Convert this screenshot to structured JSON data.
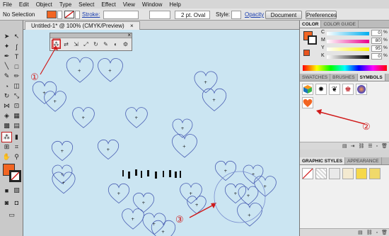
{
  "menu": [
    "File",
    "Edit",
    "Object",
    "Type",
    "Select",
    "Effect",
    "View",
    "Window",
    "Help"
  ],
  "control": {
    "selection": "No Selection",
    "stroke_label": "Stroke:",
    "brush": "2 pt. Oval",
    "style_label": "Style:",
    "opacity_link": "Opacity",
    "doc_setup": "Document Setup",
    "preferences": "Preferences"
  },
  "document": {
    "tab": "Untitled-1* @ 100% (CMYK/Preview)",
    "close": "×"
  },
  "colors": {
    "fill": "#f26522",
    "canvas": "#cbe5f2",
    "heart_stroke": "#4a5fb3",
    "annotation": "#d01a1a"
  },
  "color_panel": {
    "tabs": [
      "COLOR",
      "COLOR GUIDE"
    ],
    "channels": [
      {
        "label": "C",
        "value": "0",
        "unit": "%"
      },
      {
        "label": "M",
        "value": "80",
        "unit": "%"
      },
      {
        "label": "Y",
        "value": "95",
        "unit": "%"
      },
      {
        "label": "K",
        "value": "0",
        "unit": "%"
      }
    ]
  },
  "symbols_panel": {
    "tabs": [
      "SWATCHES",
      "BRUSHES",
      "SYMBOLS"
    ],
    "items": [
      "cube-symbol",
      "splat-symbol",
      "black-ribbon-symbol",
      "red-ribbon-symbol",
      "blue-orb-symbol",
      "orange-heart-symbol"
    ]
  },
  "styles_panel": {
    "tabs": [
      "GRAPHIC STYLES",
      "APPEARANCE"
    ]
  },
  "annotations": [
    "①",
    "②",
    "③"
  ],
  "float_panel": {
    "close": "×"
  }
}
